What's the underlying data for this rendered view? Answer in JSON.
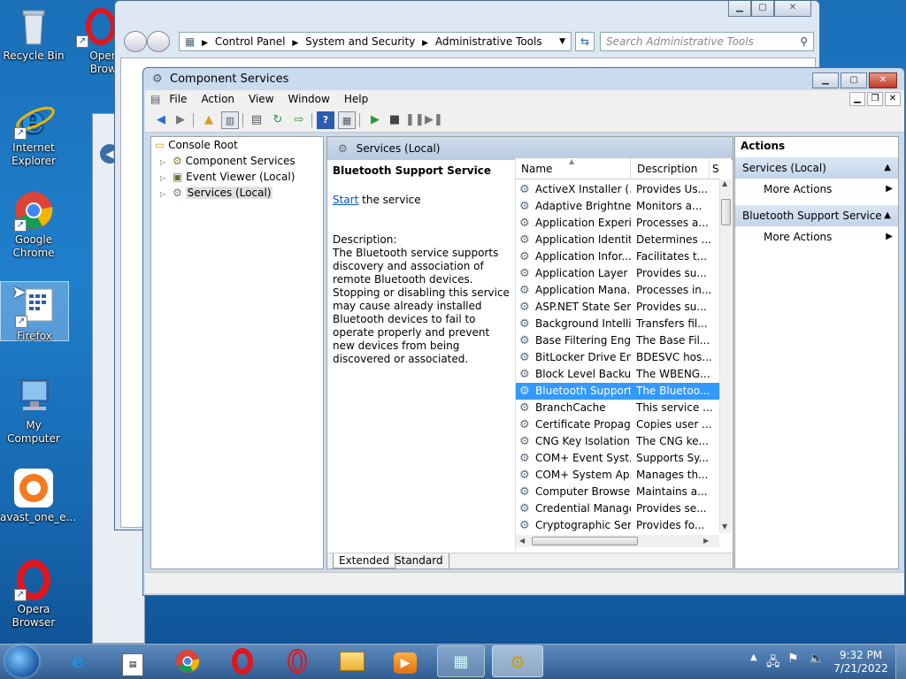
{
  "desktop": {
    "icons": [
      {
        "label": "Recycle Bin",
        "icon": "recycle-bin-icon"
      },
      {
        "label": "Opera\nBrows",
        "icon": "opera-icon"
      },
      {
        "label": "Internet\nExplorer",
        "icon": "internet-explorer-icon"
      },
      {
        "label": "Google\nChrome",
        "icon": "chrome-icon"
      },
      {
        "label": "Firefox",
        "icon": "firefox-icon"
      },
      {
        "label": "My Computer",
        "icon": "computer-icon"
      },
      {
        "label": "avast_one_e...",
        "icon": "avast-icon"
      },
      {
        "label": "Opera\nBrowser",
        "icon": "opera-icon"
      }
    ]
  },
  "explorer": {
    "breadcrumb": [
      "Control Panel",
      "System and Security",
      "Administrative Tools"
    ],
    "search_placeholder": "Search Administrative Tools"
  },
  "component_services": {
    "title": "Component Services",
    "menu": [
      "File",
      "Action",
      "View",
      "Window",
      "Help"
    ],
    "tree": {
      "root": "Console Root",
      "children": [
        "Component Services",
        "Event Viewer (Local)",
        "Services (Local)"
      ]
    },
    "services_header": "Services (Local)",
    "detail": {
      "service_name": "Bluetooth Support Service",
      "start_link": "Start",
      "start_suffix": " the service",
      "description_label": "Description:",
      "description_text": "The Bluetooth service supports discovery and association of remote Bluetooth devices.  Stopping or disabling this service may cause already installed Bluetooth devices to fail to operate properly and prevent new devices from being discovered or associated."
    },
    "columns": [
      "Name",
      "Description",
      "S"
    ],
    "services": [
      {
        "name": "ActiveX Installer (...",
        "desc": "Provides Us..."
      },
      {
        "name": "Adaptive Brightness",
        "desc": "Monitors a..."
      },
      {
        "name": "Application Experi...",
        "desc": "Processes a..."
      },
      {
        "name": "Application Identity",
        "desc": "Determines ..."
      },
      {
        "name": "Application Infor...",
        "desc": "Facilitates t..."
      },
      {
        "name": "Application Layer ...",
        "desc": "Provides su..."
      },
      {
        "name": "Application Mana...",
        "desc": "Processes in..."
      },
      {
        "name": "ASP.NET State Ser...",
        "desc": "Provides su..."
      },
      {
        "name": "Background Intelli...",
        "desc": "Transfers fil..."
      },
      {
        "name": "Base Filtering Engi...",
        "desc": "The Base Fil..."
      },
      {
        "name": "BitLocker Drive En...",
        "desc": "BDESVC hos..."
      },
      {
        "name": "Block Level Backu...",
        "desc": "The WBENG..."
      },
      {
        "name": "Bluetooth Support...",
        "desc": "The Bluetoo...",
        "selected": true
      },
      {
        "name": "BranchCache",
        "desc": "This service ..."
      },
      {
        "name": "Certificate Propag...",
        "desc": "Copies user ..."
      },
      {
        "name": "CNG Key Isolation",
        "desc": "The CNG ke..."
      },
      {
        "name": "COM+ Event Syst...",
        "desc": "Supports Sy..."
      },
      {
        "name": "COM+ System Ap...",
        "desc": "Manages th..."
      },
      {
        "name": "Computer Browser",
        "desc": "Maintains a..."
      },
      {
        "name": "Credential Manager",
        "desc": "Provides se..."
      },
      {
        "name": "Cryptographic Ser...",
        "desc": "Provides fo..."
      }
    ],
    "tabs": [
      "Extended",
      "Standard"
    ],
    "actions": {
      "title": "Actions",
      "sections": [
        {
          "header": "Services (Local)",
          "item": "More Actions"
        },
        {
          "header": "Bluetooth Support Service",
          "item": "More Actions"
        }
      ]
    }
  },
  "taskbar": {
    "time": "9:32 PM",
    "date": "7/21/2022"
  }
}
